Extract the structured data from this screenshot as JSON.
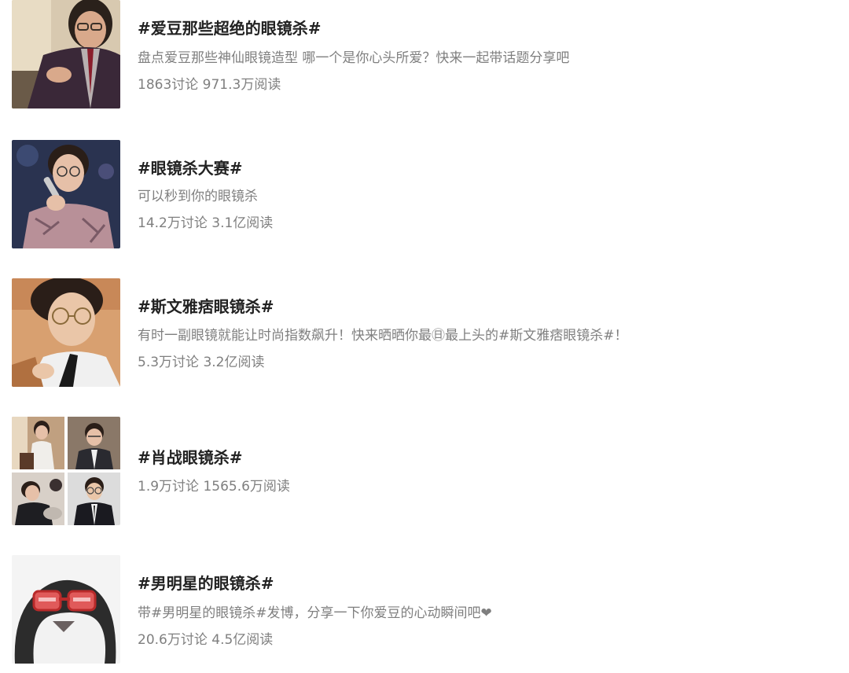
{
  "topics": [
    {
      "title": "#爱豆那些超绝的眼镜杀#",
      "description": "盘点爱豆那些神仙眼镜造型 哪一个是你心头所爱？快来一起带话题分享吧",
      "stats": "1863讨论 971.3万阅读",
      "thumbnail": "man-in-suit-with-glasses"
    },
    {
      "title": "#眼镜杀大赛#",
      "description": "可以秒到你的眼镜杀",
      "stats": "14.2万讨论 3.1亿阅读",
      "thumbnail": "singer-with-microphone"
    },
    {
      "title": "#斯文雅痞眼镜杀#",
      "description": "有时一副眼镜就能让时尚指数飙升！快来晒晒你最㊐最上头的#斯文雅痞眼镜杀#！",
      "stats": "5.3万讨论 3.2亿阅读",
      "thumbnail": "man-with-round-glasses-and-tie"
    },
    {
      "title": "#肖战眼镜杀#",
      "stats": "1.9万讨论 1565.6万阅读",
      "thumbnail": "four-photo-collage"
    },
    {
      "title": "#男明星的眼镜杀#",
      "description": "带#男明星的眼镜杀#发博，分享一下你爱豆的心动瞬间吧❤",
      "stats": "20.6万讨论 4.5亿阅读",
      "thumbnail": "penguin-with-red-glasses"
    }
  ],
  "colors": {
    "title": "#222222",
    "secondary_text": "#7f7f7f",
    "background": "#ffffff"
  }
}
